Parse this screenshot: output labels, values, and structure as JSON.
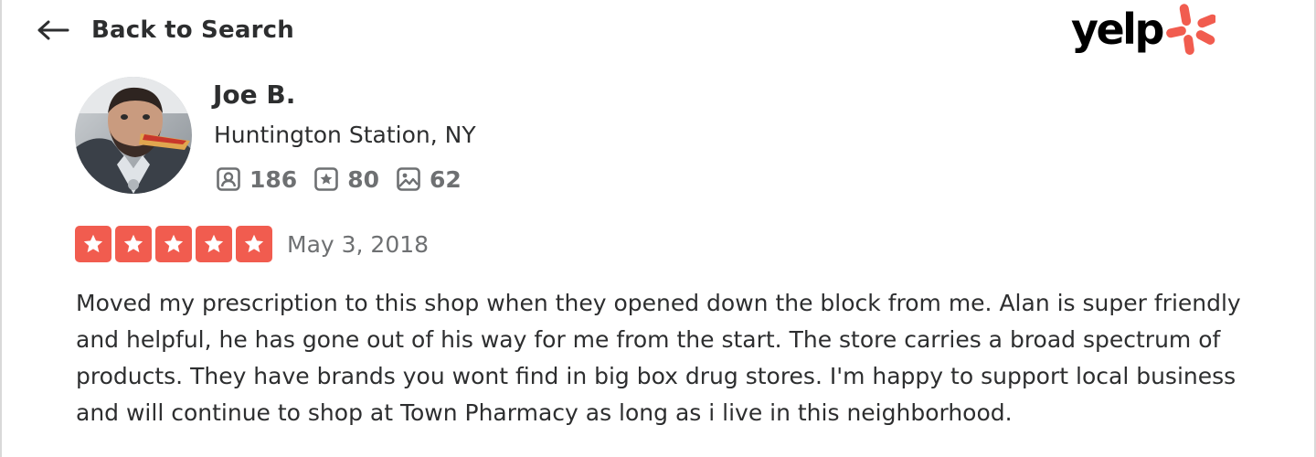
{
  "header": {
    "back_label": "Back to Search",
    "logo_text": "yelp",
    "logo_icon": "yelp-burst-icon",
    "brand_color": "#f15c4f"
  },
  "reviewer": {
    "name": "Joe B.",
    "location": "Huntington Station, NY",
    "stats": {
      "friends": "186",
      "reviews": "80",
      "photos": "62"
    }
  },
  "review": {
    "rating": 5,
    "rating_max": 5,
    "date": "May 3, 2018",
    "text": "Moved my prescription to this shop when they opened down the block from me. Alan is super friendly and helpful, he has gone out of his way for me from the start. The store carries a broad spectrum of products. They have brands you wont find in big box drug stores. I'm happy to support local business and will continue to shop at Town Pharmacy as long as i live in this neighborhood."
  }
}
